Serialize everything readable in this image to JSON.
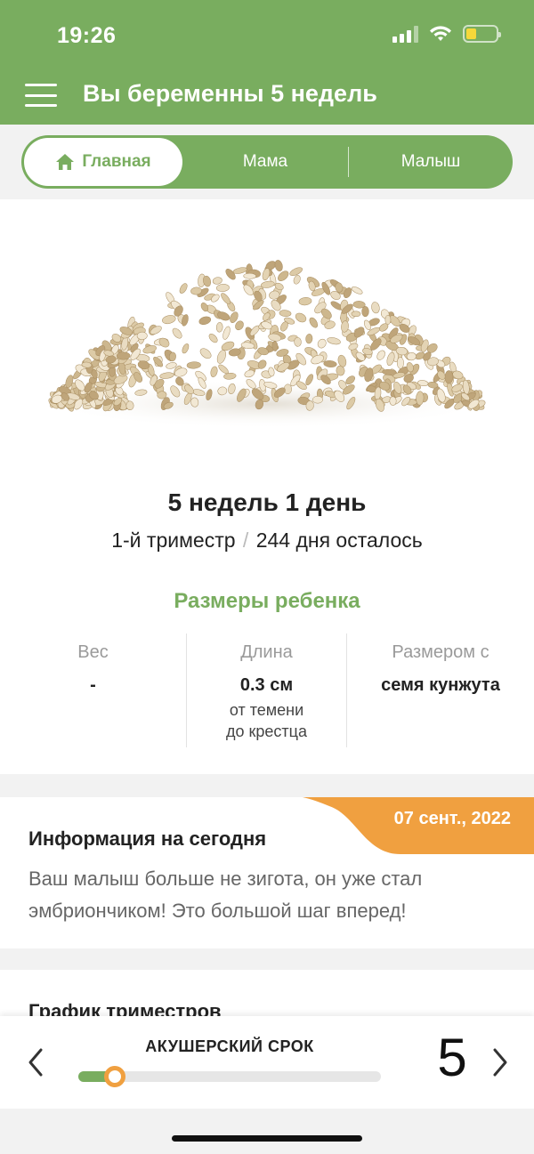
{
  "status_bar": {
    "time": "19:26"
  },
  "header": {
    "title": "Вы беременны 5 недель",
    "color": "#79ad5f"
  },
  "tabs": [
    {
      "label": "Главная",
      "active": true
    },
    {
      "label": "Мама",
      "active": false
    },
    {
      "label": "Малыш",
      "active": false
    }
  ],
  "hero": {
    "image_subject": "sesame seeds",
    "week_title": "5 недель 1 день",
    "trimester": "1-й триместр",
    "separator": "/",
    "days_left": "244 дня осталось"
  },
  "baby_sizes": {
    "title": "Размеры ребенка",
    "weight": {
      "label": "Вес",
      "value": "-"
    },
    "length": {
      "label": "Длина",
      "value": "0.3 см",
      "note_line1": "от темени",
      "note_line2": "до крестца"
    },
    "size_as": {
      "label": "Размером с",
      "value": "семя кунжута"
    }
  },
  "info": {
    "date": "07 сент., 2022",
    "title": "Информация на сегодня",
    "text": "Ваш малыш больше не зигота, он уже стал эмбриончиком! Это большой шаг вперед!"
  },
  "trimester_chart": {
    "title": "График триместров"
  },
  "bottom_bar": {
    "label": "АКУШЕРСКИЙ СРОК",
    "week": "5",
    "progress_fraction": 0.12
  },
  "colors": {
    "accent": "#79ad5f",
    "badge": "#f0a040"
  }
}
